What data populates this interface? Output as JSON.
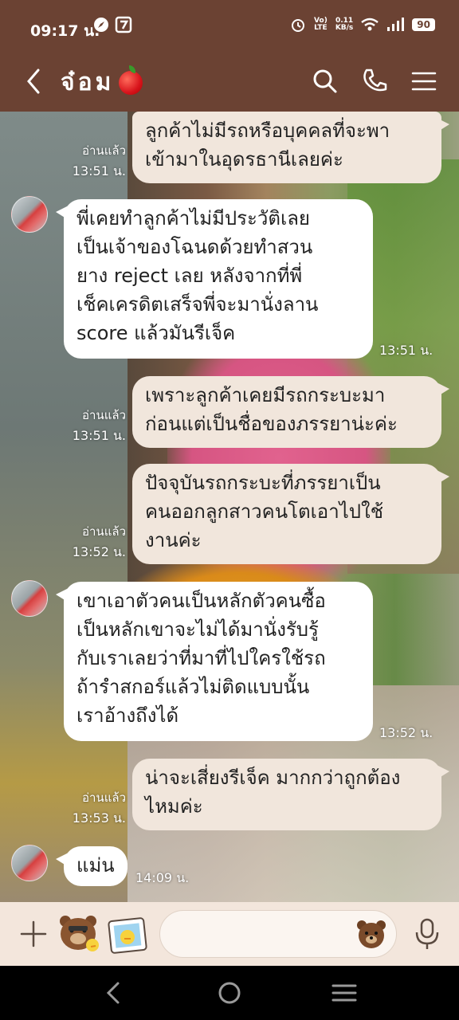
{
  "status_bar": {
    "time": "09:17 น.",
    "net_lines": [
      "Vo)",
      "LTE"
    ],
    "speed_lines": [
      "0.11",
      "KB/s"
    ],
    "battery": "90"
  },
  "header": {
    "title": "จ๋อม",
    "title_emoji_name": "red-apple-icon",
    "icons": [
      "back-icon",
      "search-icon",
      "phone-icon",
      "menu-icon"
    ]
  },
  "messages": [
    {
      "side": "me",
      "lines": [
        "ลูกค้าไม่มีรถหรือบุคคลที่จะพา",
        "เข้ามาในอุดรธานีเลยค่ะ"
      ],
      "read": "อ่านแล้ว",
      "time": "13:51 น."
    },
    {
      "side": "them",
      "lines": [
        "พี่เคยทำลูกค้าไม่มีประวัติเลย",
        "เป็นเจ้าของโฉนดด้วยทำสวน",
        "ยาง reject เลย หลังจากที่พี่",
        "เช็คเครดิตเสร็จพี่จะมานั่งลาน",
        "score แล้วมันรีเจ็ค"
      ],
      "time": "13:51 น."
    },
    {
      "side": "me",
      "lines": [
        "เพราะลูกค้าเคยมีรถกระบะมา",
        "ก่อนแต่เป็นชื่อของภรรยาน่ะค่ะ"
      ],
      "read": "อ่านแล้ว",
      "time": "13:51 น."
    },
    {
      "side": "me",
      "lines": [
        "ปัจจุบันรถกระบะที่ภรรยาเป็น",
        "คนออกลูกสาวคนโตเอาไปใช้",
        "งานค่ะ"
      ],
      "read": "อ่านแล้ว",
      "time": "13:52 น."
    },
    {
      "side": "them",
      "lines": [
        "เขาเอาตัวคนเป็นหลักตัวคนซื้อ",
        "เป็นหลักเขาจะไม่ได้มานั่งรับรู้",
        "กับเราเลยว่าที่มาที่ไปใครใช้รถ",
        "ถ้ารำสกอร์แล้วไม่ติดแบบนั้น",
        "เราอ้างถึงได้"
      ],
      "time": "13:52 น."
    },
    {
      "side": "me",
      "lines": [
        "น่าจะเสี่ยงรีเจ็ค มากกว่าถูกต้อง",
        "ไหมค่ะ"
      ],
      "read": "อ่านแล้ว",
      "time": "13:53 น."
    },
    {
      "side": "them",
      "lines": [
        "แม่น"
      ],
      "time": "14:09 น."
    }
  ],
  "input_bar": {
    "placeholder": "",
    "icons": [
      "plus-icon",
      "sticker-icon",
      "photo-icon",
      "emoji-icon",
      "mic-icon"
    ]
  },
  "nav_bar": {
    "icons": [
      "nav-back-icon",
      "nav-home-icon",
      "nav-recents-icon"
    ]
  },
  "colors": {
    "header_bg": "#6b4233",
    "my_bubble": "#f1e6dc",
    "their_bubble": "#ffffff",
    "input_bar_bg": "#f3e6dc"
  }
}
